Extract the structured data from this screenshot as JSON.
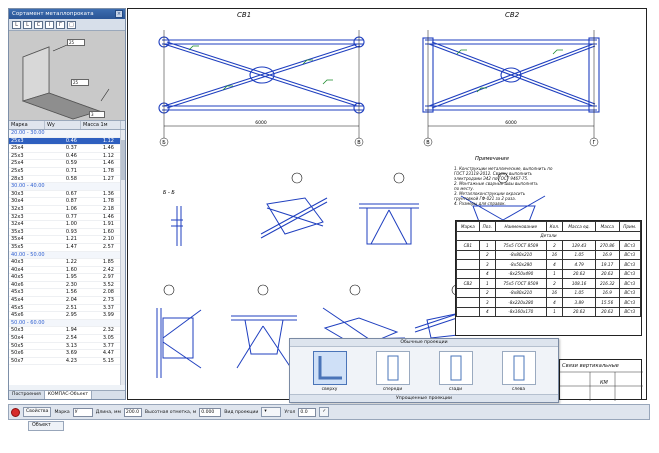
{
  "panel": {
    "title": "Сортамент металлопроката",
    "icons": [
      "L",
      "L",
      "C",
      "I",
      "Г",
      "□"
    ],
    "dims": [
      "25",
      "25",
      "3"
    ],
    "columns": [
      "Марка",
      "Wy",
      "Масса 1м"
    ],
    "rows": [
      {
        "type": "group",
        "label": "20.00 - 30.00"
      },
      {
        "type": "row",
        "a": "25x3",
        "b": "0.46",
        "c": "1.12",
        "sel": true
      },
      {
        "type": "row",
        "a": "25x4",
        "b": "0.37",
        "c": "1.46"
      },
      {
        "type": "row",
        "a": "25x3",
        "b": "0.46",
        "c": "1.12"
      },
      {
        "type": "row",
        "a": "25x4",
        "b": "0.59",
        "c": "1.46"
      },
      {
        "type": "row",
        "a": "25x5",
        "b": "0.71",
        "c": "1.78"
      },
      {
        "type": "row",
        "a": "28x3",
        "b": "0.58",
        "c": "1.27"
      },
      {
        "type": "group",
        "label": "30.00 - 40.00"
      },
      {
        "type": "row",
        "a": "30x3",
        "b": "0.67",
        "c": "1.36"
      },
      {
        "type": "row",
        "a": "30x4",
        "b": "0.87",
        "c": "1.78"
      },
      {
        "type": "row",
        "a": "32x3",
        "b": "1.06",
        "c": "2.18"
      },
      {
        "type": "row",
        "a": "32x3",
        "b": "0.77",
        "c": "1.46"
      },
      {
        "type": "row",
        "a": "32x4",
        "b": "1.00",
        "c": "1.91"
      },
      {
        "type": "row",
        "a": "35x3",
        "b": "0.93",
        "c": "1.60"
      },
      {
        "type": "row",
        "a": "35x4",
        "b": "1.21",
        "c": "2.10"
      },
      {
        "type": "row",
        "a": "35x5",
        "b": "1.47",
        "c": "2.57"
      },
      {
        "type": "group",
        "label": "40.00 - 50.00"
      },
      {
        "type": "row",
        "a": "40x3",
        "b": "1.22",
        "c": "1.85"
      },
      {
        "type": "row",
        "a": "40x4",
        "b": "1.60",
        "c": "2.42"
      },
      {
        "type": "row",
        "a": "40x5",
        "b": "1.95",
        "c": "2.97"
      },
      {
        "type": "row",
        "a": "40x6",
        "b": "2.30",
        "c": "3.52"
      },
      {
        "type": "row",
        "a": "45x3",
        "b": "1.56",
        "c": "2.08"
      },
      {
        "type": "row",
        "a": "45x4",
        "b": "2.04",
        "c": "2.73"
      },
      {
        "type": "row",
        "a": "45x5",
        "b": "2.51",
        "c": "3.37"
      },
      {
        "type": "row",
        "a": "45x6",
        "b": "2.95",
        "c": "3.99"
      },
      {
        "type": "group",
        "label": "50.00 - 60.00"
      },
      {
        "type": "row",
        "a": "50x3",
        "b": "1.94",
        "c": "2.32"
      },
      {
        "type": "row",
        "a": "50x4",
        "b": "2.54",
        "c": "3.05"
      },
      {
        "type": "row",
        "a": "50x5",
        "b": "3.13",
        "c": "3.77"
      },
      {
        "type": "row",
        "a": "50x6",
        "b": "3.69",
        "c": "4.47"
      },
      {
        "type": "row",
        "a": "50x7",
        "b": "4.23",
        "c": "5.15"
      }
    ],
    "tabs": [
      "Построения",
      "КОМПАС-Объект"
    ]
  },
  "drawing": {
    "sheet_left": "СВ1",
    "sheet_right": "СВ2",
    "section_label": "Б - Б",
    "notes_title": "Примечания",
    "notes": [
      "1. Конструкции металлические, выполнить по",
      "ГОСТ 23118-2012. Сварку выполнить",
      "электродами Э42 по ГОСТ 9467-75.",
      "2. Монтажные сварные швы выполнять",
      "по месту.",
      "3. Металлоконструкции окрасить",
      "грунтовкой ГФ-021 за 2 раза.",
      "4. Размеры для справок."
    ],
    "axis_left": [
      "Б",
      "В"
    ],
    "axis_right": [
      "В",
      "Г"
    ],
    "dim_left": "6000",
    "dim_right": "6000"
  },
  "spec": {
    "headers": [
      "Марка",
      "Поз.",
      "Наименование",
      "Кол.",
      "Масса ед.",
      "Масса",
      "Прим."
    ],
    "group": "Детали",
    "rows": [
      [
        "СВ1",
        "1",
        "75x5 ГОСТ 8509",
        "2",
        "129.43",
        "270.86",
        "ВСт3"
      ],
      [
        "",
        "2",
        "-8x80x210",
        "16",
        "1.05",
        "16.9",
        "ВСт3"
      ],
      [
        "",
        "3",
        "-8x50x280",
        "4",
        "4.79",
        "19.17",
        "ВСт3"
      ],
      [
        "",
        "4",
        "-8x250x490",
        "1",
        "20.62",
        "20.62",
        "ВСт3"
      ],
      [
        "СВ2",
        "1",
        "75x5 ГОСТ 8509",
        "2",
        "108.16",
        "216.32",
        "ВСт3"
      ],
      [
        "",
        "2",
        "-8x80x210",
        "16",
        "1.05",
        "16.9",
        "ВСт3"
      ],
      [
        "",
        "3",
        "-8x220x280",
        "4",
        "3.89",
        "15.56",
        "ВСт3"
      ],
      [
        "",
        "4",
        "-8x160x170",
        "1",
        "20.62",
        "20.62",
        "ВСт3"
      ]
    ]
  },
  "popup": {
    "title": "Обычные проекции",
    "items": [
      "сверху",
      "спереди",
      "сзади",
      "слева"
    ],
    "footer": "Упрощенные проекции"
  },
  "title_block": {
    "name": "Связи вертикальные",
    "sheet": "КМ"
  },
  "status": {
    "properties": "Свойства",
    "mark_label": "Марка",
    "mark_value": "У",
    "length_label": "Длина, мм",
    "length_value": "200.0",
    "height_label": "Высотная отметка, м",
    "height_value": "0.000",
    "view_label": "Вид проекции",
    "angle_label": "Угол",
    "angle_value": "0.0",
    "bottom_tab": "Объект"
  },
  "colors": {
    "accent": "#2e5fbf",
    "drawing_blue": "#1f3fbf",
    "stop": "#d62b2b"
  }
}
